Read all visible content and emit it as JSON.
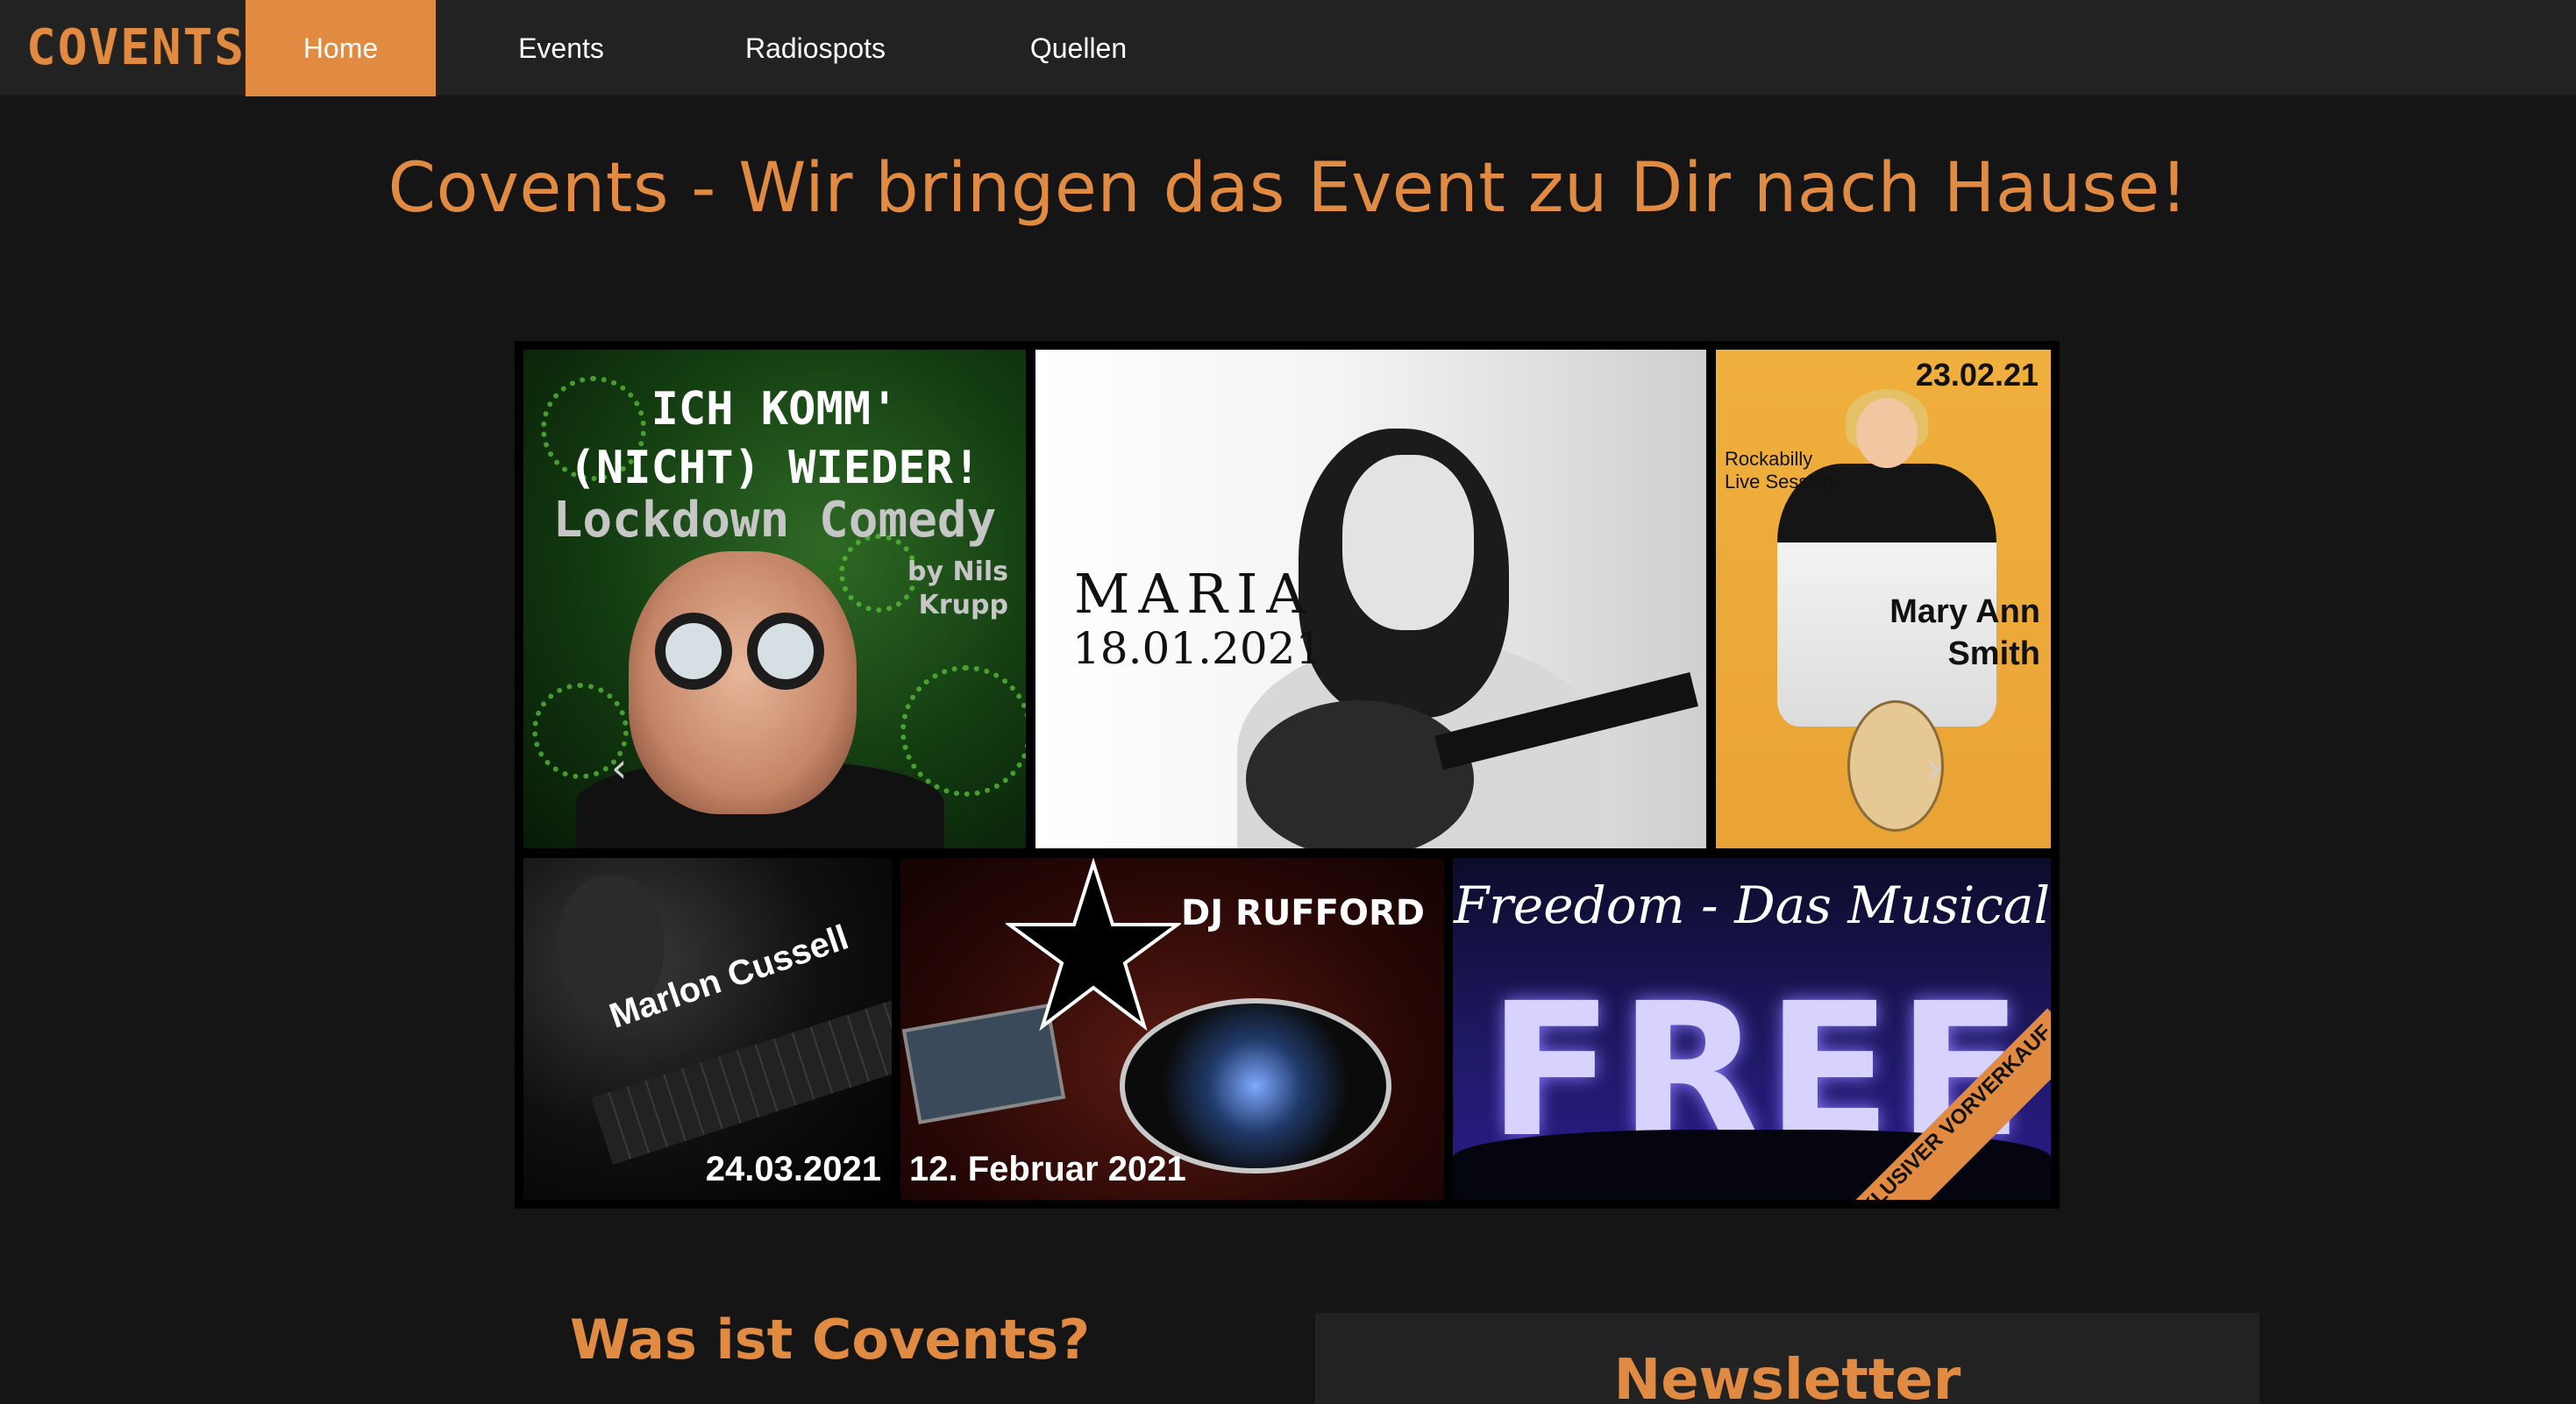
{
  "brand": {
    "logo_text": "COVENTS",
    "accent_color": "#e08a42"
  },
  "nav": {
    "items": [
      {
        "label": "Home",
        "active": true
      },
      {
        "label": "Events",
        "active": false
      },
      {
        "label": "Radiospots",
        "active": false
      },
      {
        "label": "Quellen",
        "active": false
      }
    ]
  },
  "hero": {
    "title": "Covents - Wir bringen das Event zu Dir nach Hause!"
  },
  "carousel": {
    "prev_icon": "chevron-left-icon",
    "next_icon": "chevron-right-icon",
    "tiles": [
      {
        "line1": "ICH KOMM'",
        "line2": "(NICHT) WIEDER!",
        "line3": "Lockdown Comedy",
        "line4": "by Nils Krupp"
      },
      {
        "name": "MARIA",
        "date": "18.01.2021"
      },
      {
        "date": "23.02.21",
        "sub": "Rockabilly Live Session",
        "name": "Mary Ann Smith"
      },
      {
        "name": "Marlon Cussell",
        "date": "24.03.2021"
      },
      {
        "name": "DJ RUFFORD",
        "date": "12. Februar 2021"
      },
      {
        "title": "Freedom - Das Musical",
        "big": "FREE",
        "ribbon": "EXKLUSIVER VORVERKAUF"
      }
    ]
  },
  "about": {
    "title": "Was ist Covents?"
  },
  "newsletter": {
    "title": "Newsletter"
  }
}
